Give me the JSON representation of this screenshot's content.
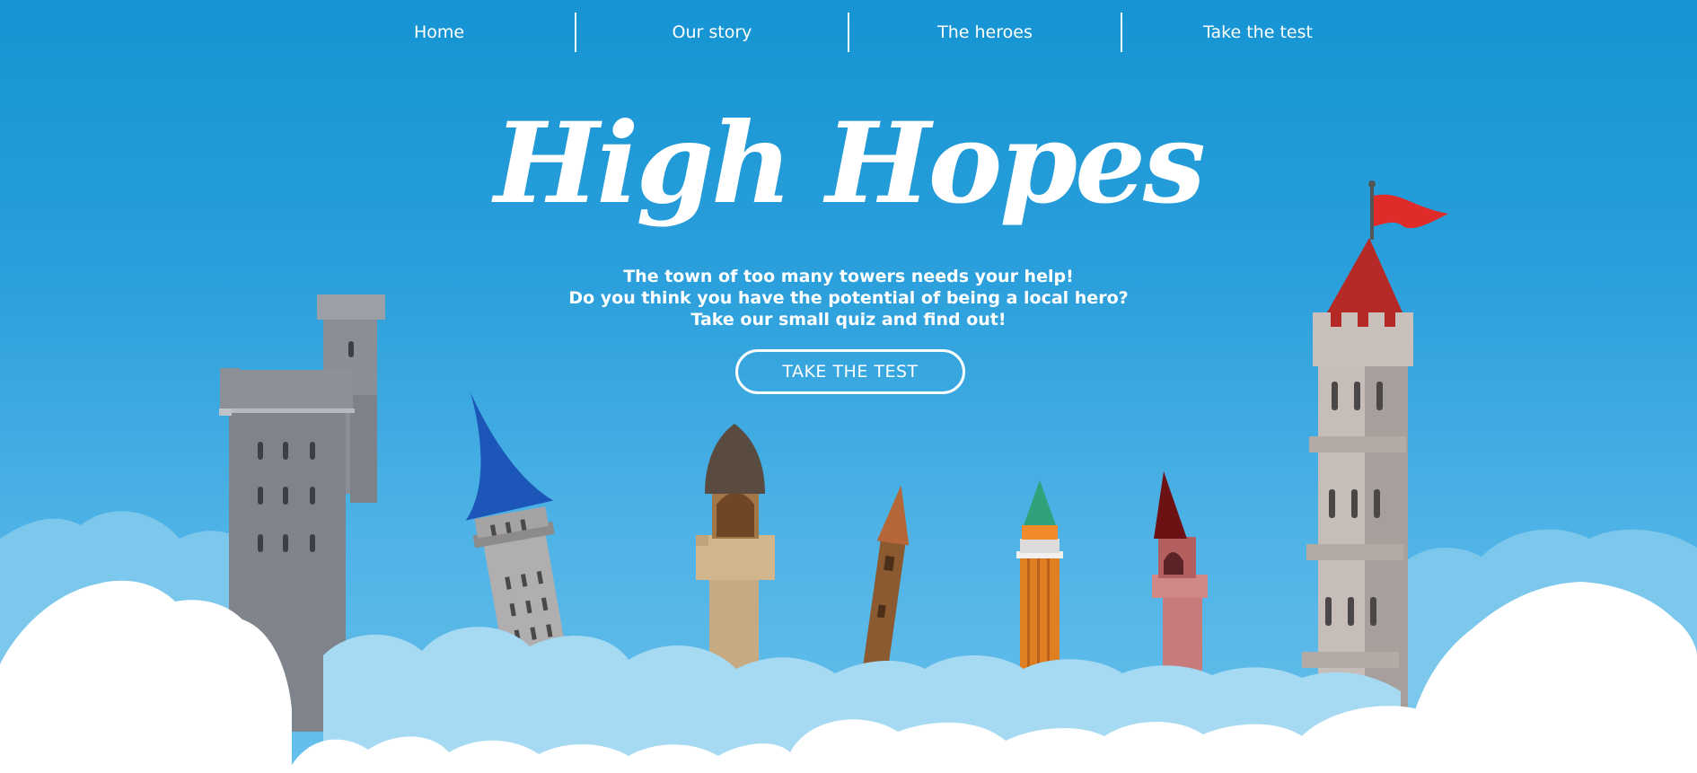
{
  "nav": {
    "items": [
      {
        "label": "Home"
      },
      {
        "label": "Our story"
      },
      {
        "label": "The heroes"
      },
      {
        "label": "Take the test"
      }
    ]
  },
  "hero": {
    "title": "High Hopes",
    "tagline_lines": [
      "The town of too many towers needs your help!",
      "Do you think you have the potential of being a local hero?",
      "Take our small quiz and find out!"
    ],
    "cta_label": "TAKE THE TEST"
  },
  "colors": {
    "sky_top": "#1594d3",
    "sky_bottom": "#67c0ec",
    "cloud_back": "#7cc8ec",
    "cloud_mid": "#a6d9f2",
    "cloud_front": "#ffffff",
    "flag": "#e02b2b",
    "roof_red": "#b52a26",
    "roof_blue": "#1b56b8"
  }
}
